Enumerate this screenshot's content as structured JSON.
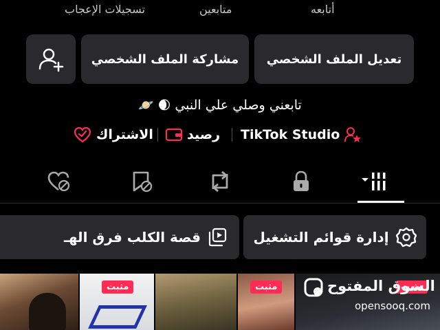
{
  "stats": {
    "following_label": "أتابعه",
    "followers_label": "متابعين",
    "likes_label": "تسجيلات الإعجاب"
  },
  "actions": {
    "edit_profile": "تعديل الملف الشخصي",
    "share_profile": "مشاركة الملف الشخصي",
    "add_friend_icon": "person-plus-icon"
  },
  "bio": {
    "text": "تابعني وصلي علي النبي",
    "emoji": [
      "🌒",
      "🪐"
    ]
  },
  "links": {
    "studio": "TikTok Studio",
    "balance": "رصيد",
    "subscription": "الاشتراك"
  },
  "tabs": [
    {
      "icon": "grid-icon",
      "active": true
    },
    {
      "icon": "lock-icon",
      "active": false
    },
    {
      "icon": "repost-icon",
      "active": false
    },
    {
      "icon": "bookmark-hidden-icon",
      "active": false
    },
    {
      "icon": "liked-hidden-icon",
      "active": false
    }
  ],
  "chips": {
    "playlists": "إدارة قوائم التشغيل",
    "story": "قصة الكلب فرق الهـ"
  },
  "thumbnails": {
    "pinned_label": "مثبت"
  },
  "watermark": {
    "brand": "السوق المفتوح",
    "site": "opensooq.com"
  },
  "colors": {
    "accent": "#fe2c55",
    "button_bg": "#2a2a2c",
    "background": "#000000"
  }
}
